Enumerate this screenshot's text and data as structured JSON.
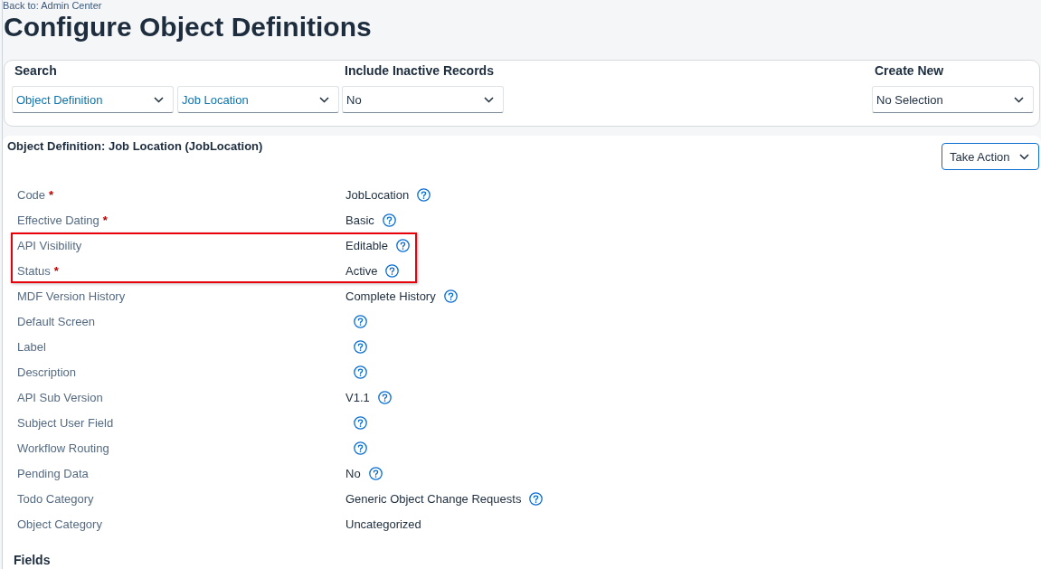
{
  "back_link": "Back to: Admin Center",
  "title": "Configure Object Definitions",
  "filter_bar": {
    "groups": [
      {
        "label": "Search",
        "kind": "search",
        "selects": [
          "Object Definition",
          "Job Location"
        ]
      },
      {
        "label": "Include Inactive Records",
        "kind": "option",
        "selects": [
          "No"
        ]
      },
      {
        "label": "Create New",
        "kind": "option",
        "selects": [
          "No Selection"
        ]
      }
    ]
  },
  "required_marker": "*",
  "detail": {
    "heading": "Object Definition: Job Location (JobLocation)",
    "action_button": "Take Action",
    "rows": [
      {
        "label": "Code",
        "required": true,
        "value": "JobLocation",
        "help": true,
        "highlighted": false
      },
      {
        "label": "Effective Dating",
        "required": true,
        "value": "Basic",
        "help": true,
        "highlighted": false
      },
      {
        "label": "API Visibility",
        "required": false,
        "value": "Editable",
        "help": true,
        "highlighted": true
      },
      {
        "label": "Status",
        "required": true,
        "value": "Active",
        "help": true,
        "highlighted": true
      },
      {
        "label": "MDF Version History",
        "required": false,
        "value": "Complete History",
        "help": true,
        "highlighted": false
      },
      {
        "label": "Default Screen",
        "required": false,
        "help": true,
        "highlighted": false
      },
      {
        "label": "Label",
        "required": false,
        "help": true,
        "highlighted": false
      },
      {
        "label": "Description",
        "required": false,
        "help": true,
        "highlighted": false
      },
      {
        "label": "API Sub Version",
        "required": false,
        "value": "V1.1",
        "help": true,
        "highlighted": false
      },
      {
        "label": "Subject User Field",
        "required": false,
        "help": true,
        "highlighted": false
      },
      {
        "label": "Workflow Routing",
        "required": false,
        "help": true,
        "highlighted": false
      },
      {
        "label": "Pending Data",
        "required": false,
        "value": "No",
        "help": true,
        "highlighted": false
      },
      {
        "label": "Todo Category",
        "required": false,
        "value": "Generic Object Change Requests",
        "help": true,
        "highlighted": false
      },
      {
        "label": "Object Category",
        "required": false,
        "value": "Uncategorized",
        "help": false,
        "highlighted": false
      }
    ]
  },
  "fields_heading": "Fields"
}
